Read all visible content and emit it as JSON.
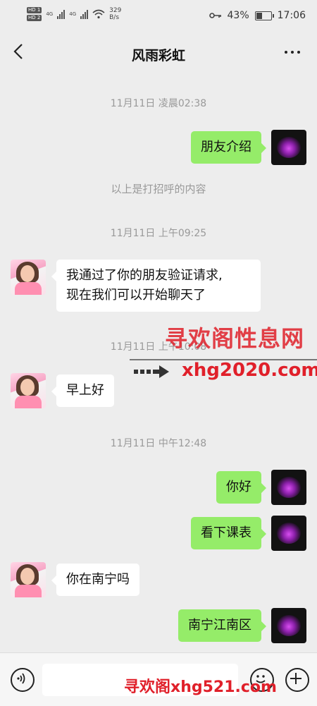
{
  "status_bar": {
    "net_speed": "329",
    "net_unit": "B/s",
    "sim1": "HD 1",
    "sim2": "HD 2",
    "network1": "4G",
    "network2": "4G",
    "battery_percent": "43%",
    "battery_level": 0.43,
    "time": "17:06",
    "icons": [
      "hd-icon",
      "signal-icon",
      "wifi-icon",
      "key-icon",
      "battery-icon"
    ]
  },
  "header": {
    "title": "风雨彩虹"
  },
  "chat": {
    "timestamps": [
      "11月11日 凌晨02:38",
      "11月11日 上午09:25",
      "11月11日 上午10:08",
      "11月11日 中午12:48"
    ],
    "system_note": "以上是打招呼的内容",
    "messages": [
      {
        "from": "me",
        "text": "朋友介绍"
      },
      {
        "from": "them",
        "text": "我通过了你的朋友验证请求,\n现在我们可以开始聊天了"
      },
      {
        "from": "them",
        "text": "早上好"
      },
      {
        "from": "me",
        "text": "你好"
      },
      {
        "from": "me",
        "text": "看下课表"
      },
      {
        "from": "them",
        "text": "你在南宁吗"
      },
      {
        "from": "me",
        "text": "南宁江南区"
      }
    ]
  },
  "watermarks": {
    "title_cn": "寻欢阁性息网",
    "url1": "xhg2020.com",
    "bottom": "寻欢阁xhg521.com"
  },
  "colors": {
    "my_bubble": "#95ec69",
    "their_bubble": "#ffffff",
    "background": "#ededed",
    "watermark_red": "#e0202a"
  }
}
